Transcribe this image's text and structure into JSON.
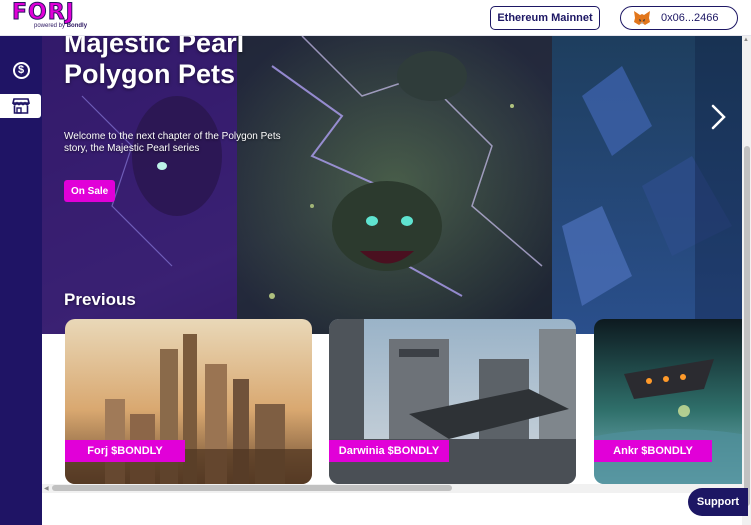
{
  "header": {
    "logo_text": "FORJ",
    "logo_powered": "powered by",
    "logo_brand": "Bondly",
    "network_label": "Ethereum Mainnet",
    "wallet_address": "0x06...2466"
  },
  "sidebar": {
    "items": [
      {
        "icon": "dollar-coin-icon",
        "glyph": "$"
      },
      {
        "icon": "store-icon"
      }
    ]
  },
  "hero": {
    "title": "Majestic Pearl Polygon Pets",
    "description": "Welcome to the next chapter of the Polygon Pets story, the Majestic Pearl series",
    "cta_label": "On Sale"
  },
  "previous": {
    "heading": "Previous",
    "cards": [
      {
        "label": "Forj $BONDLY"
      },
      {
        "label": "Darwinia $BONDLY"
      },
      {
        "label": "Ankr $BONDLY"
      }
    ]
  },
  "support_label": "Support",
  "colors": {
    "brand_navy": "#1d1764",
    "sidebar": "#1f1465",
    "accent_magenta": "#e100d8"
  }
}
